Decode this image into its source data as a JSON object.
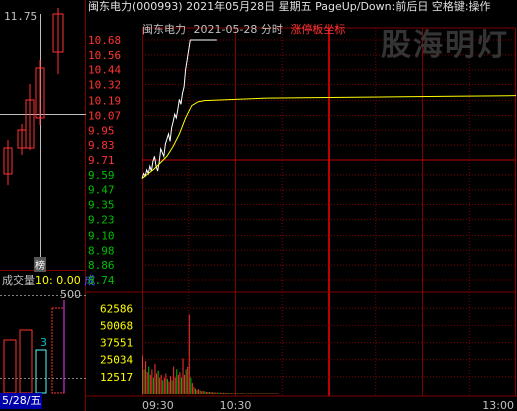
{
  "title_bar": {
    "stock": "闽东电力(000993)",
    "datetime": "2021年05月28日 星期五",
    "hint": "PageUp/Down:前后日 空格键:操作"
  },
  "chart_header": {
    "name": "闽东电力",
    "date": "2021-05-28 分时",
    "tag": "涨停板坐标"
  },
  "watermark": "股海明灯",
  "left_panel": {
    "price_label": "11.75",
    "vol_label_name": "成交量",
    "vol_label_value": "10: 0.00",
    "vol_label_extra": "成",
    "vol_scale": "500",
    "marker": "3",
    "tag": "榜",
    "date_label": "5/28/五"
  },
  "colors": {
    "up": "#ff3232",
    "down": "#54fcfc",
    "price_line": "#ffffff",
    "avg_line": "#ffff00",
    "grid": "#800000",
    "axis_up": "#ff3232",
    "axis_down": "#00c000",
    "volume_up": "#ff3232",
    "volume_down": "#00c000"
  },
  "chart_data": {
    "type": "line",
    "title": "闽东电力 2021-05-28 分时",
    "y_ticks": [
      "10.68",
      "10.56",
      "10.44",
      "10.32",
      "10.19",
      "10.07",
      "9.95",
      "9.83",
      "9.71",
      "9.59",
      "9.47",
      "9.35",
      "9.23",
      "9.10",
      "8.98",
      "8.86",
      "8.74"
    ],
    "ylim": [
      8.74,
      10.68
    ],
    "prev_close": 9.71,
    "volume_ticks": [
      "62586",
      "50068",
      "37551",
      "25034",
      "12517"
    ],
    "x_ticks": [
      "09:30",
      "10:30",
      "13:00"
    ],
    "series": [
      {
        "name": "price",
        "x": [
          0,
          1,
          2,
          3,
          4,
          5,
          6,
          7,
          8,
          9,
          10,
          11,
          12,
          13,
          14,
          15,
          16,
          17,
          18,
          19,
          20,
          21,
          22,
          23,
          24,
          25,
          26,
          27,
          28,
          29,
          30,
          31,
          32,
          33,
          34,
          35,
          36,
          37,
          38,
          39,
          40,
          41,
          42,
          43,
          44,
          45,
          46,
          47,
          48
        ],
        "values": [
          9.56,
          9.6,
          9.58,
          9.63,
          9.6,
          9.66,
          9.62,
          9.7,
          9.74,
          9.66,
          9.62,
          9.69,
          9.8,
          9.77,
          9.74,
          9.84,
          9.88,
          9.92,
          9.86,
          9.97,
          10.02,
          10.08,
          10.05,
          10.12,
          10.2,
          10.16,
          10.25,
          10.3,
          10.44,
          10.52,
          10.6,
          10.68,
          10.68,
          10.68,
          10.68,
          10.68,
          10.68,
          10.68,
          10.68,
          10.68,
          10.68,
          10.68,
          10.68,
          10.68,
          10.68,
          10.68,
          10.68,
          10.68,
          10.68
        ]
      },
      {
        "name": "avg",
        "x": [
          0,
          4,
          8,
          12,
          16,
          20,
          24,
          28,
          32,
          36,
          40,
          60,
          80,
          120,
          160,
          200,
          240
        ],
        "values": [
          9.56,
          9.6,
          9.64,
          9.69,
          9.74,
          9.82,
          9.92,
          10.05,
          10.15,
          10.18,
          10.19,
          10.2,
          10.21,
          10.215,
          10.22,
          10.225,
          10.23
        ]
      }
    ],
    "volume": [
      28000,
      18000,
      24000,
      16000,
      20000,
      14000,
      18000,
      12000,
      22000,
      15000,
      17000,
      12000,
      14000,
      10000,
      12000,
      15000,
      11000,
      9000,
      13000,
      10000,
      20000,
      12000,
      18000,
      14000,
      16000,
      12000,
      26000,
      14000,
      18000,
      20000,
      58000,
      12000,
      8000,
      5000,
      4000,
      3000,
      3500,
      2500,
      2000,
      2200,
      1800,
      1600,
      1500,
      1400,
      1300,
      1200,
      1100,
      1000,
      1000,
      900,
      900,
      800,
      800,
      700,
      700,
      700,
      600,
      600,
      600,
      500,
      500,
      500,
      500,
      500,
      500,
      400,
      400,
      400,
      400,
      400,
      400,
      400,
      400,
      400,
      400,
      400,
      400,
      400,
      400,
      400,
      400,
      400,
      400,
      400,
      400,
      400,
      400,
      400
    ],
    "total_minutes": 240
  }
}
